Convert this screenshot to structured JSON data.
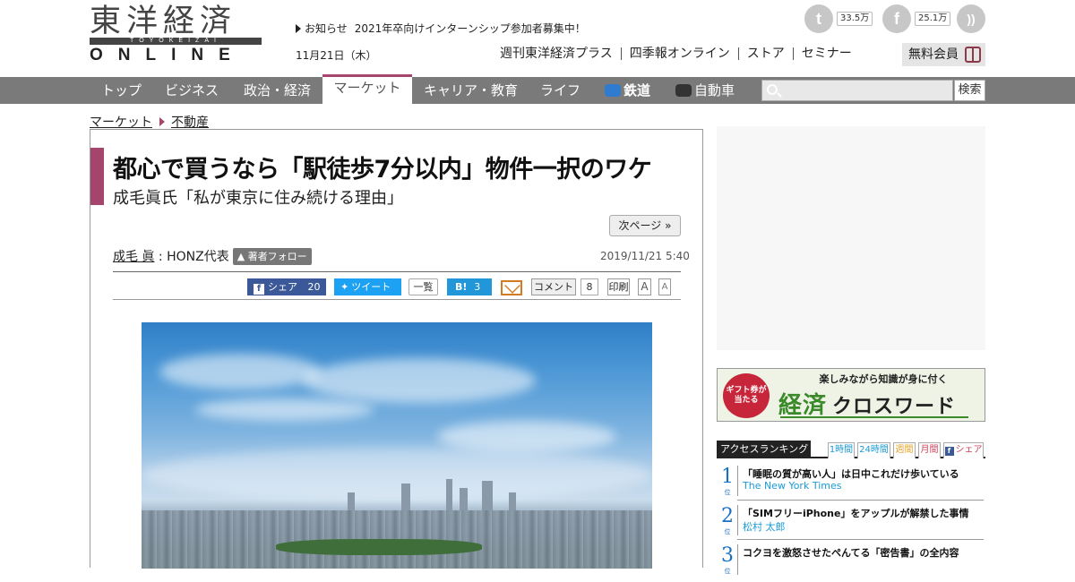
{
  "header": {
    "logo_kanji": "東洋経済",
    "logo_band": "TOYOKEIZAI",
    "logo_online": "ONLINE",
    "news_label": "お知らせ",
    "news_text": "2021年卒向けインターンシップ参加者募集中！",
    "date": "11月21日（木）",
    "social": {
      "twitter_count": "33.5万",
      "facebook_count": "25.1万"
    },
    "subnav": [
      "週刊東洋経済プラス",
      "四季報オンライン",
      "ストア",
      "セミナー"
    ],
    "member_label": "無料会員"
  },
  "nav": {
    "items": [
      "トップ",
      "ビジネス",
      "政治・経済",
      "マーケット",
      "キャリア・教育",
      "ライフ",
      "鉄道",
      "自動車"
    ],
    "active": "マーケット",
    "search_placeholder": "",
    "search_button": "検索"
  },
  "breadcrumb": [
    "マーケット",
    "不動産"
  ],
  "article": {
    "title": "都心で買うなら「駅徒歩7分以内」物件一択のワケ",
    "subtitle": "成毛眞氏「私が東京に住み続ける理由」",
    "next_page": "次ページ »",
    "author_name": "成毛 眞",
    "author_role": "HONZ代表",
    "follow_label": "著者フォロー",
    "published": "2019/11/21 5:40",
    "share": {
      "facebook_label": "シェア",
      "facebook_count": "20",
      "twitter_label": "ツイート",
      "twitter_list": "一覧",
      "hatena_label": "B!",
      "hatena_count": "3",
      "comment_label": "コメント",
      "comment_count": "8",
      "print_label": "印刷",
      "font_large": "A",
      "font_small": "A"
    }
  },
  "sidebar": {
    "banner": {
      "badge": "ギフト券が当たる",
      "tagline": "楽しみながら知識が身に付く",
      "title_a": "経済",
      "title_b": "クロスワード"
    },
    "ranking": {
      "title": "アクセスランキング",
      "tabs": [
        "1時間",
        "24時間",
        "週間",
        "月間",
        "シェア"
      ],
      "items": [
        {
          "rank": "1",
          "suffix": "位",
          "title": "「睡眠の質が高い人」は日中これだけ歩いている",
          "author": "The New York Times"
        },
        {
          "rank": "2",
          "suffix": "位",
          "title": "「SIMフリーiPhone」をアップルが解禁した事情",
          "author": "松村 太郎"
        },
        {
          "rank": "3",
          "suffix": "位",
          "title": "コクヨを激怒させたぺんてる「密告書」の全内容",
          "author": ""
        }
      ]
    }
  },
  "colors": {
    "accent": "#a5456e",
    "nav_bg": "#7a7a7a",
    "link_blue": "#1a9ad6",
    "facebook": "#3b5998",
    "twitter": "#1da1f2",
    "hatena": "#2196d9"
  }
}
